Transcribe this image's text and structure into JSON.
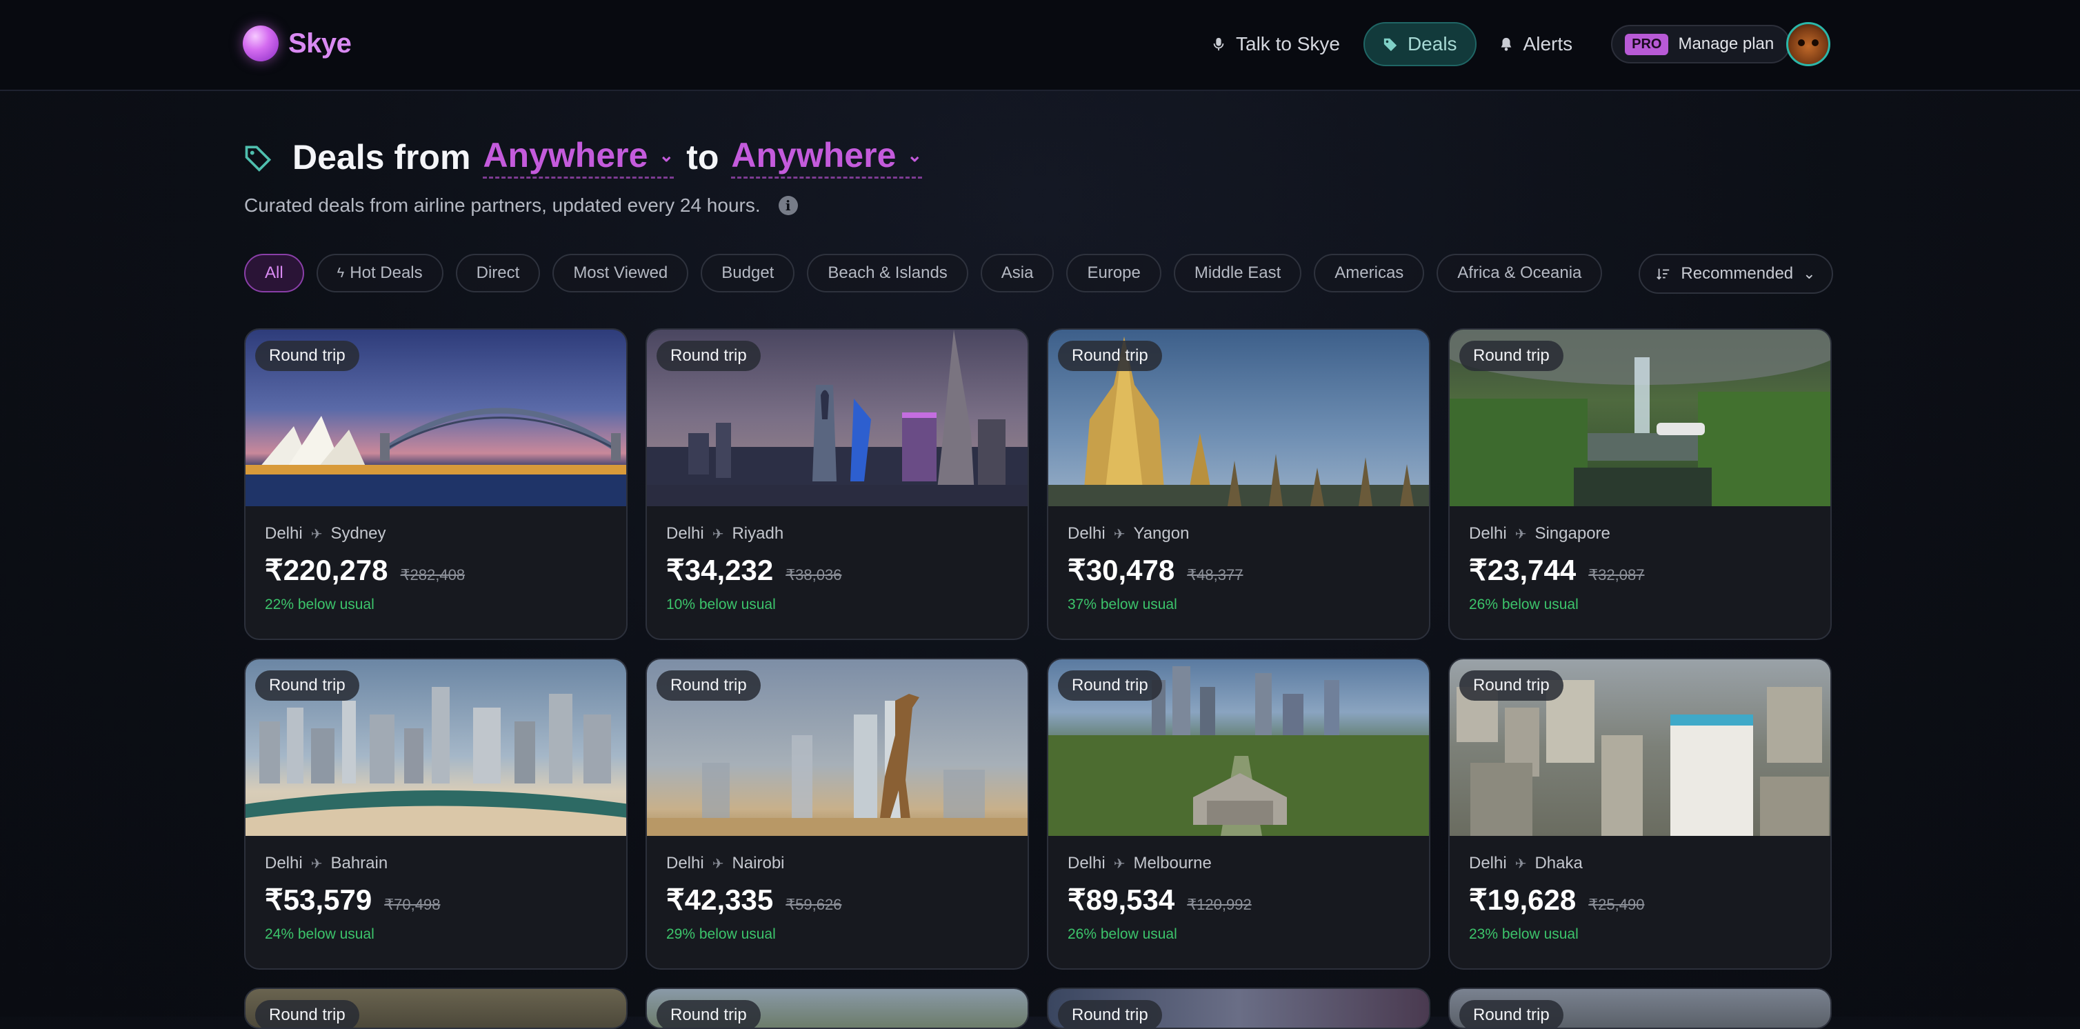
{
  "app": {
    "name": "Skye"
  },
  "nav": {
    "talk": "Talk to Skye",
    "deals": "Deals",
    "alerts": "Alerts",
    "pro_badge": "PRO",
    "manage": "Manage plan"
  },
  "heading": {
    "prefix": "Deals from",
    "from": "Anywhere",
    "to_word": "to",
    "to": "Anywhere",
    "subtitle": "Curated deals from airline partners, updated every 24 hours."
  },
  "filters": [
    "All",
    "Hot Deals",
    "Direct",
    "Most Viewed",
    "Budget",
    "Beach & Islands",
    "Asia",
    "Europe",
    "Middle East",
    "Americas",
    "Africa & Oceania"
  ],
  "sort": {
    "label": "Recommended"
  },
  "deals": [
    {
      "badge": "Round trip",
      "from": "Delhi",
      "to": "Sydney",
      "price": "₹220,278",
      "old": "₹282,408",
      "below": "22% below usual"
    },
    {
      "badge": "Round trip",
      "from": "Delhi",
      "to": "Riyadh",
      "price": "₹34,232",
      "old": "₹38,036",
      "below": "10% below usual"
    },
    {
      "badge": "Round trip",
      "from": "Delhi",
      "to": "Yangon",
      "price": "₹30,478",
      "old": "₹48,377",
      "below": "37% below usual"
    },
    {
      "badge": "Round trip",
      "from": "Delhi",
      "to": "Singapore",
      "price": "₹23,744",
      "old": "₹32,087",
      "below": "26% below usual"
    },
    {
      "badge": "Round trip",
      "from": "Delhi",
      "to": "Bahrain",
      "price": "₹53,579",
      "old": "₹70,498",
      "below": "24% below usual"
    },
    {
      "badge": "Round trip",
      "from": "Delhi",
      "to": "Nairobi",
      "price": "₹42,335",
      "old": "₹59,626",
      "below": "29% below usual"
    },
    {
      "badge": "Round trip",
      "from": "Delhi",
      "to": "Melbourne",
      "price": "₹89,534",
      "old": "₹120,992",
      "below": "26% below usual"
    },
    {
      "badge": "Round trip",
      "from": "Delhi",
      "to": "Dhaka",
      "price": "₹19,628",
      "old": "₹25,490",
      "below": "23% below usual"
    }
  ],
  "partial_badges": [
    "Round trip",
    "Round trip",
    "Round trip",
    "Round trip"
  ],
  "icons": {
    "logo": "orb-logo-icon",
    "talk": "microphone-icon",
    "deals": "tag-icon",
    "alerts": "bell-icon",
    "heading": "tag-icon",
    "info": "info-icon",
    "hot": "bolt-icon",
    "sort": "sort-icon",
    "route": "airplane-icon"
  },
  "colors": {
    "accent": "#c45bdc",
    "teal": "#2bb7a9",
    "success": "#3cc46b",
    "background": "#0c0f16"
  }
}
